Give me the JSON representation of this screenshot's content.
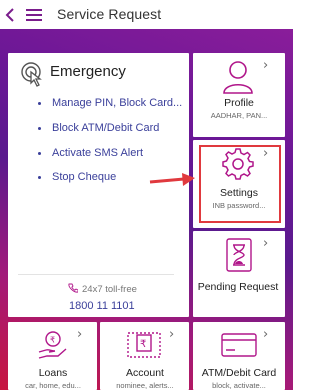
{
  "header": {
    "title": "Service Request"
  },
  "emergency": {
    "title": "Emergency",
    "items": [
      "Manage PIN, Block Card...",
      "Block ATM/Debit Card",
      "Activate SMS Alert",
      "Stop Cheque"
    ],
    "tollfree_label": "24x7 toll-free",
    "tollfree_number": "1800 11 1101"
  },
  "tiles": {
    "profile": {
      "title": "Profile",
      "subtitle": "AADHAR, PAN..."
    },
    "settings": {
      "title": "Settings",
      "subtitle": "INB password..."
    },
    "pending": {
      "title": "Pending Request"
    },
    "loans": {
      "title": "Loans",
      "subtitle": "car, home, edu..."
    },
    "account": {
      "title": "Account",
      "subtitle": "nominee, alerts..."
    },
    "atm": {
      "title": "ATM/Debit Card",
      "subtitle": "block, activate..."
    }
  },
  "colors": {
    "accent": "#b0168a",
    "link": "#3a3f9a",
    "highlight": "#e0393e"
  }
}
